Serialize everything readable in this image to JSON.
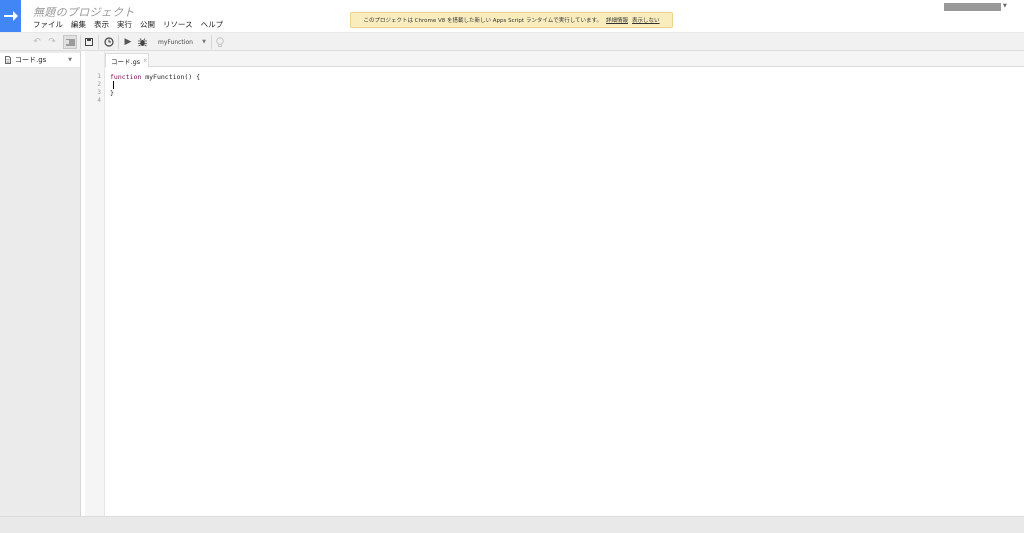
{
  "app": {
    "title": "無題のプロジェクト",
    "logo_icon": "arrow-right-icon",
    "brand_color": "#4285f4"
  },
  "menu": [
    "ファイル",
    "編集",
    "表示",
    "実行",
    "公開",
    "リソース",
    "ヘルプ"
  ],
  "notice": {
    "text": "このプロジェクトは Chrome V8 を搭載した新しい Apps Script ランタイムで実行しています。",
    "link_details": "詳細情報",
    "link_hide": "表示しない"
  },
  "toolbar": {
    "function_select": "myFunction"
  },
  "sidebar": {
    "file_name": "コード.gs"
  },
  "tab": {
    "label": "コード.gs",
    "close": "×"
  },
  "editor": {
    "line_numbers": [
      "1",
      "2",
      "3",
      "4"
    ],
    "line1_keyword": "function",
    "line1_rest": " myFunction() {",
    "line3": "}"
  }
}
